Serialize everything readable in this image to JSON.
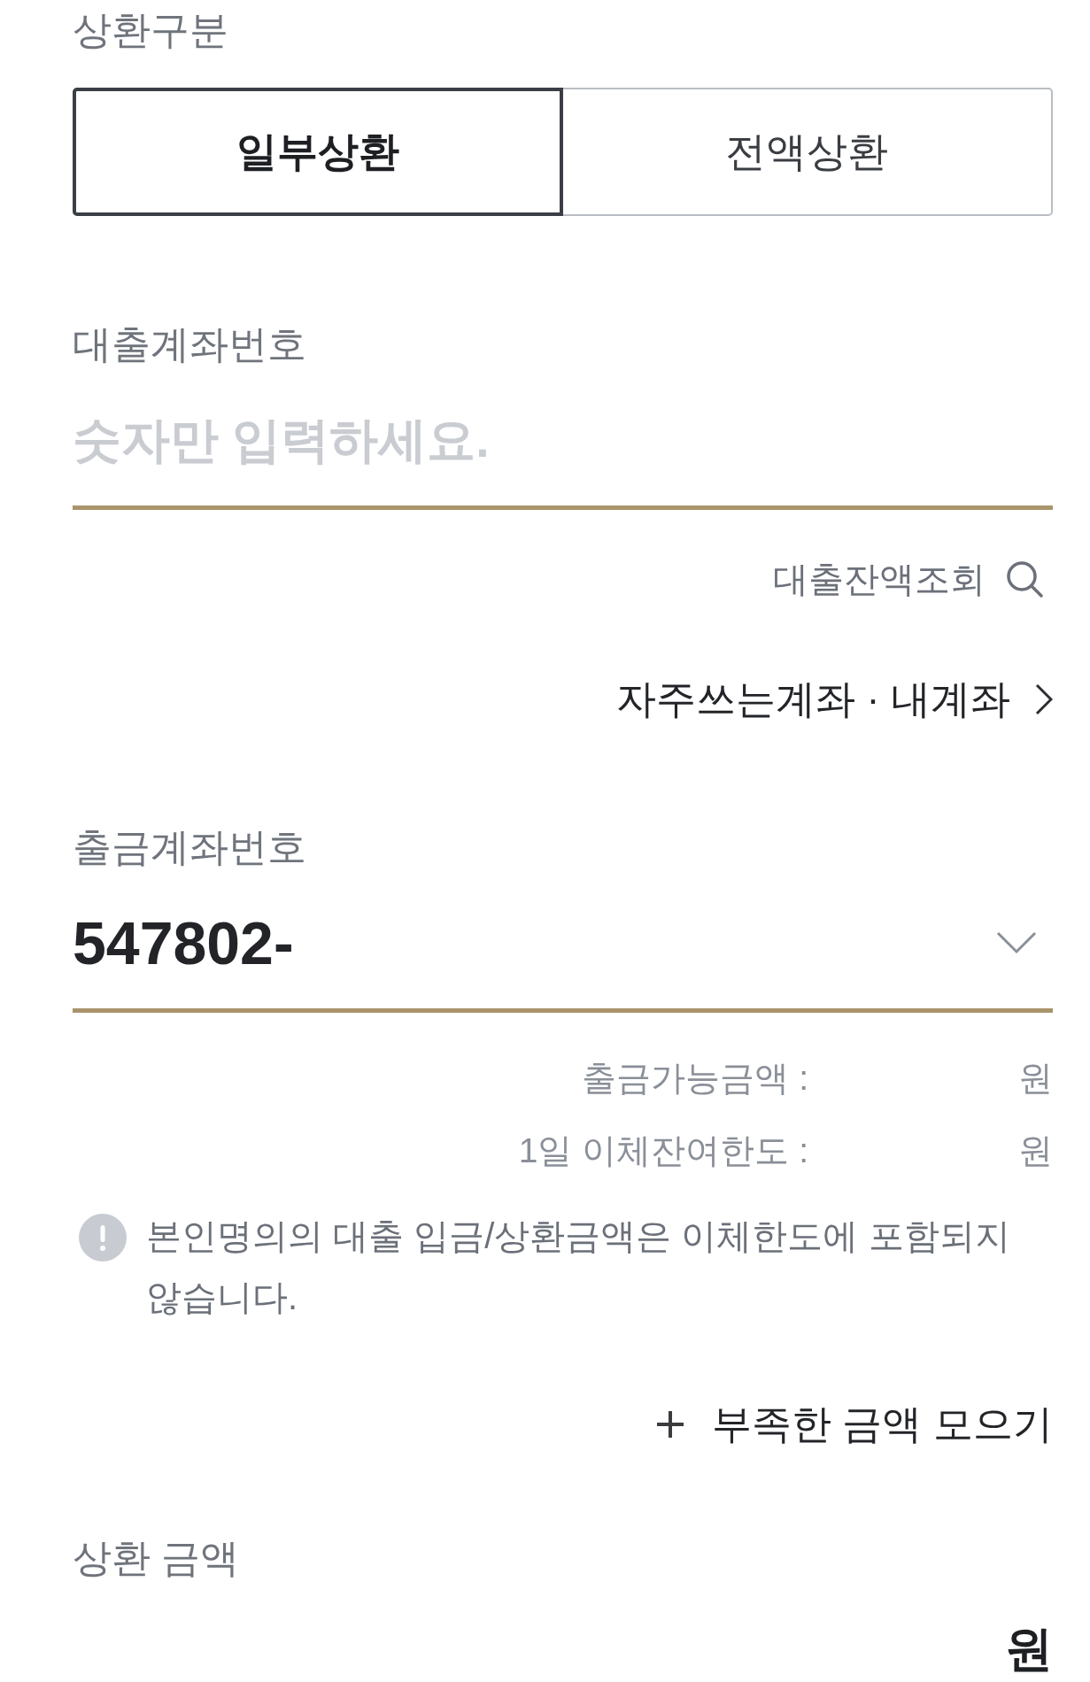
{
  "repayment_type": {
    "label": "상환구분",
    "options": [
      {
        "label": "일부상환",
        "selected": true
      },
      {
        "label": "전액상환",
        "selected": false
      }
    ]
  },
  "loan_account": {
    "label": "대출계좌번호",
    "placeholder": "숫자만 입력하세요.",
    "balance_lookup": "대출잔액조회",
    "account_link": "자주쓰는계좌 · 내계좌"
  },
  "withdrawal_account": {
    "label": "출금계좌번호",
    "value": "547802-",
    "limits": [
      {
        "label": "출금가능금액 :",
        "unit": "원"
      },
      {
        "label": "1일 이체잔여한도 :",
        "unit": "원"
      }
    ]
  },
  "notice": "본인명의의 대출 입금/상환금액은 이체한도에 포함되지 않습니다.",
  "collect_button": "부족한 금액 모으기",
  "repayment_amount": {
    "label": "상환 금액",
    "unit": "원"
  }
}
